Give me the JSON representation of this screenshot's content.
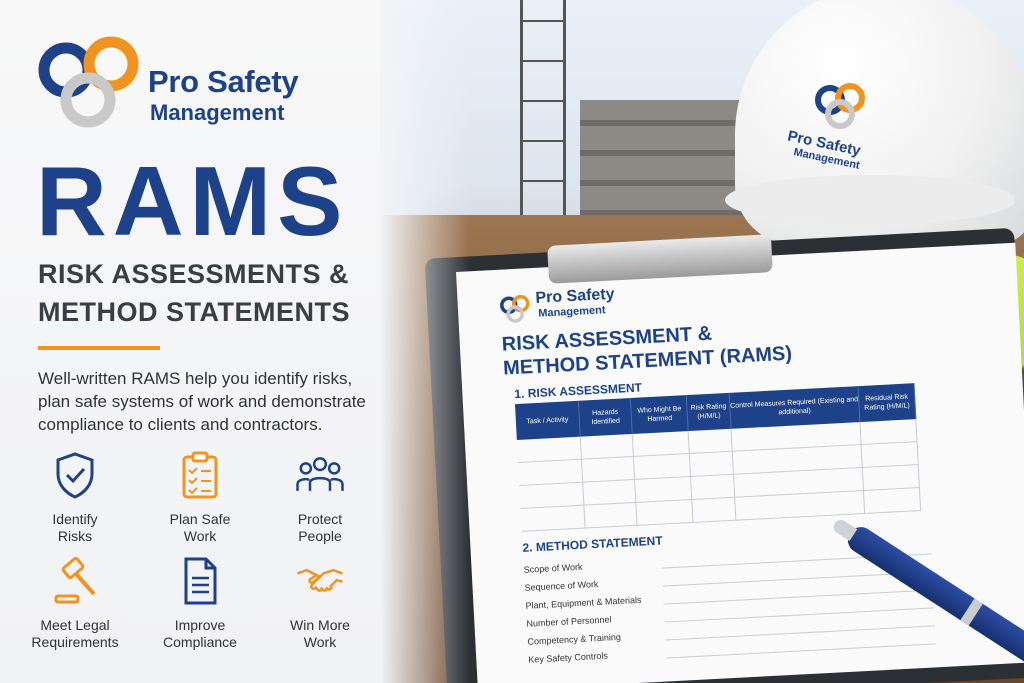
{
  "brand": {
    "name": "Pro Safety",
    "sub": "Management"
  },
  "headline": "RAMS",
  "subheadline": [
    "RISK ASSESSMENTS &",
    "METHOD STATEMENTS"
  ],
  "description": "Well-written RAMS help you identify risks, plan safe systems of work and demonstrate compliance to clients and contractors.",
  "colors": {
    "navy": "#1d4289",
    "orange": "#f0941f",
    "grey": "#c9c9c9"
  },
  "features": [
    {
      "icon": "shield-check-icon",
      "lines": [
        "Identify",
        "Risks"
      ]
    },
    {
      "icon": "clipboard-checklist-icon",
      "lines": [
        "Plan Safe",
        "Work"
      ]
    },
    {
      "icon": "people-group-icon",
      "lines": [
        "Protect",
        "People"
      ]
    },
    {
      "icon": "gavel-icon",
      "lines": [
        "Meet Legal",
        "Requirements"
      ]
    },
    {
      "icon": "document-icon",
      "lines": [
        "Improve",
        "Compliance"
      ]
    },
    {
      "icon": "handshake-icon",
      "lines": [
        "Win More",
        "Work"
      ]
    }
  ],
  "document": {
    "brand": "Pro Safety",
    "brand_sub": "Management",
    "title": [
      "RISK ASSESSMENT &",
      "METHOD STATEMENT (RAMS)"
    ],
    "section1": "1. RISK ASSESSMENT",
    "columns": [
      "Task / Activity",
      "Hazards Identified",
      "Who Might Be Harmed",
      "Risk Rating (H/M/L)",
      "Control Measures Required (Existing and additional)",
      "Residual Risk Rating (H/M/L)"
    ],
    "section2": "2. METHOD STATEMENT",
    "fields": [
      "Scope of Work",
      "Sequence of Work",
      "Plant, Equipment & Materials",
      "Number of Personnel",
      "Competency & Training",
      "Key Safety Controls"
    ]
  },
  "helmet": {
    "brand": "Pro Safety",
    "sub": "Management"
  }
}
